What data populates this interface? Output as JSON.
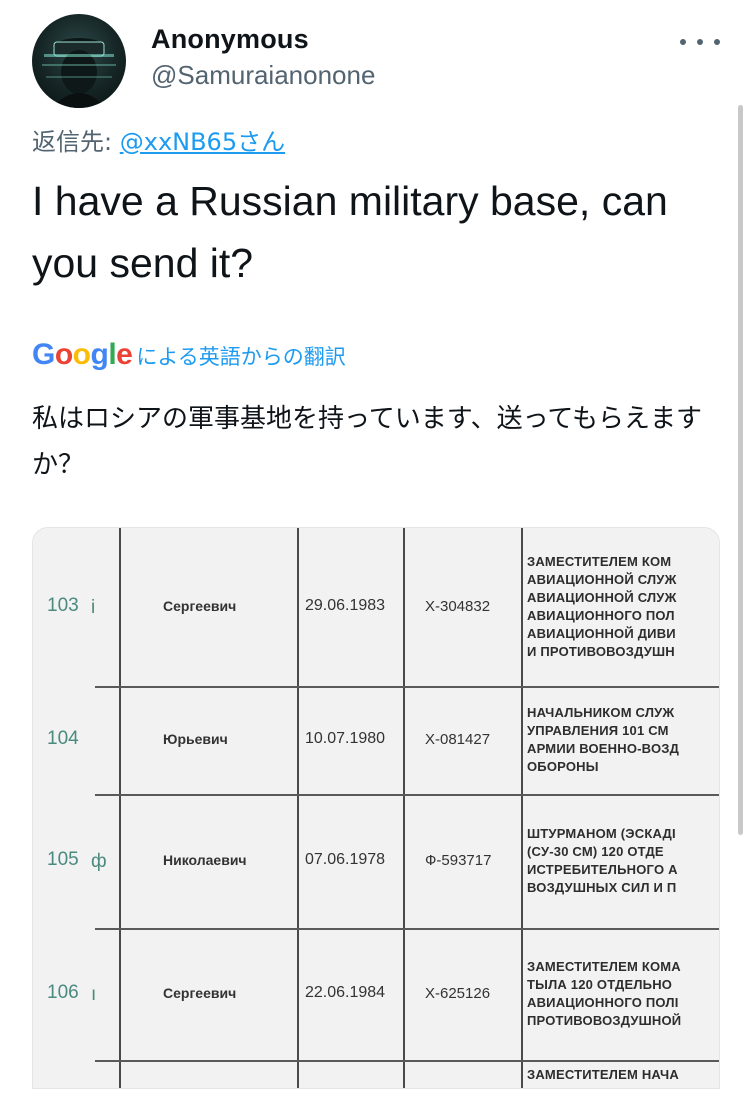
{
  "user": {
    "display_name": "Anonymous",
    "handle": "@Samuraianonone"
  },
  "reply": {
    "prefix": "返信先:",
    "mention": "@xxNB65さん"
  },
  "tweet": {
    "text": "I have a Russian military base, can you send it?"
  },
  "translation": {
    "provider": "Google",
    "label": "による英語からの翻訳",
    "text": "私はロシアの軍事基地を持っています、送ってもらえますか？"
  },
  "media": {
    "rows": [
      {
        "num": "103",
        "mark": "i",
        "patronymic": "Сергеевич",
        "date": "29.06.1983",
        "id": "Х-304832",
        "desc": [
          "ЗАМЕСТИТЕЛЕМ КОМ",
          "АВИАЦИОННОЙ СЛУЖ",
          "АВИАЦИОННОЙ СЛУЖ",
          "АВИАЦИОННОГО ПОЛ",
          "АВИАЦИОННОЙ ДИВИ",
          "И ПРОТИВОВОЗДУШН"
        ]
      },
      {
        "num": "104",
        "mark": "",
        "patronymic": "Юрьевич",
        "date": "10.07.1980",
        "id": "Х-081427",
        "desc": [
          "НАЧАЛЬНИКОМ СЛУЖ",
          "УПРАВЛЕНИЯ 101 СМ",
          "АРМИИ ВОЕННО-ВОЗД",
          "ОБОРОНЫ"
        ]
      },
      {
        "num": "105",
        "mark": "ф",
        "patronymic": "Николаевич",
        "date": "07.06.1978",
        "id": "Ф-593717",
        "desc": [
          "ШТУРМАНОМ (ЭСКАДІ",
          "(СУ-30 СМ) 120 ОТДЕ",
          "ИСТРЕБИТЕЛЬНОГО А",
          "ВОЗДУШНЫХ СИЛ И П"
        ]
      },
      {
        "num": "106",
        "mark": "ı",
        "patronymic": "Сергеевич",
        "date": "22.06.1984",
        "id": "Х-625126",
        "desc": [
          "ЗАМЕСТИТЕЛЕМ КОМА",
          "ТЫЛА 120 ОТДЕЛЬНО",
          "АВИАЦИОННОГО ПОЛІ",
          "ПРОТИВОВОЗДУШНОЙ"
        ]
      }
    ],
    "footer_desc": "ЗАМЕСТИТЕЛЕМ НАЧА"
  }
}
